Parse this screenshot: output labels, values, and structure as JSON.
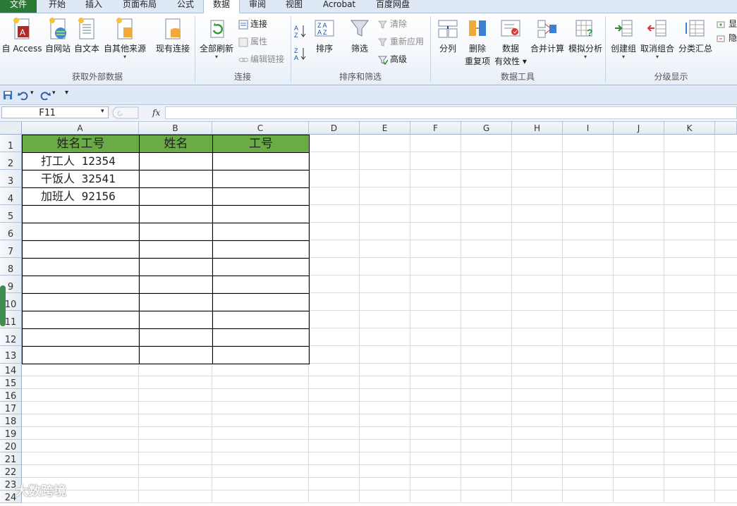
{
  "tabs": [
    "文件",
    "开始",
    "插入",
    "页面布局",
    "公式",
    "数据",
    "审阅",
    "视图",
    "Acrobat",
    "百度网盘"
  ],
  "ribbon": {
    "get_external": {
      "title": "获取外部数据",
      "access": "自 Access",
      "web": "自网站",
      "text": "自文本",
      "other": "自其他来源",
      "existing": "现有连接"
    },
    "connections": {
      "title": "连接",
      "refresh_all": "全部刷新",
      "connections": "连接",
      "properties": "属性",
      "edit_links": "编辑链接"
    },
    "sort_filter": {
      "title": "排序和筛选",
      "sort": "排序",
      "filter": "筛选",
      "clear": "清除",
      "reapply": "重新应用",
      "advanced": "高级"
    },
    "data_tools": {
      "title": "数据工具",
      "text_to_columns": "分列",
      "remove_dup_1": "删除",
      "remove_dup_2": "重复项",
      "validation_1": "数据",
      "validation_2": "有效性",
      "consolidate": "合并计算",
      "what_if": "模拟分析"
    },
    "outline": {
      "title": "分级显示",
      "group": "创建组",
      "ungroup": "取消组合",
      "subtotal": "分类汇总",
      "show": "显",
      "hide": "隐"
    }
  },
  "formula_bar": {
    "name_box": "F11",
    "fx": "fx",
    "value": ""
  },
  "columns": [
    "A",
    "B",
    "C",
    "D",
    "E",
    "F",
    "G",
    "H",
    "I",
    "J",
    "K"
  ],
  "rows": [
    "1",
    "2",
    "3",
    "4",
    "5",
    "6",
    "7",
    "8",
    "9",
    "10",
    "11",
    "12",
    "13",
    "14",
    "15",
    "16",
    "17",
    "18",
    "19",
    "20",
    "21",
    "22",
    "23",
    "24"
  ],
  "table": {
    "headers": [
      "姓名工号",
      "姓名",
      "工号"
    ],
    "rows": [
      [
        "打工人 12354",
        "",
        ""
      ],
      [
        "干饭人 32541",
        "",
        ""
      ],
      [
        "加班人 92156",
        "",
        ""
      ]
    ]
  },
  "watermark": "大数跨境",
  "colors": {
    "header_fill": "#6aab46",
    "file_tab": "#2a7a35"
  }
}
